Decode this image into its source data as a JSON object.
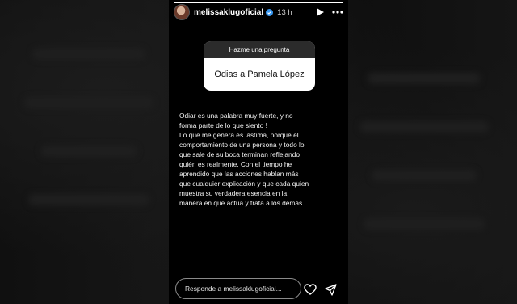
{
  "story": {
    "progress": 1.0,
    "username": "melissaklugoficial",
    "time": "13 h",
    "question": {
      "header": "Hazme una pregunta",
      "text": "Odias a Pamela López"
    },
    "answer": "Odiar es una palabra muy fuerte, y no\nforma parte de lo que siento !\nLo que me genera es lástima, porque el\ncomportamiento de una persona y todo lo\nque sale de su boca terminan reflejando\nquién es realmente. Con el tiempo he\naprendido que las acciones hablan más\nque cualquier explicación y que cada quien\nmuestra su verdadera esencia en la\nmanera en que actúa y trata a los demás.",
    "reply_placeholder": "Responde a melissaklugoficial...",
    "icons": {
      "verified": "verified-badge-icon",
      "play": "play-icon",
      "more": "more-options-icon",
      "like": "heart-icon",
      "share": "send-icon"
    }
  }
}
